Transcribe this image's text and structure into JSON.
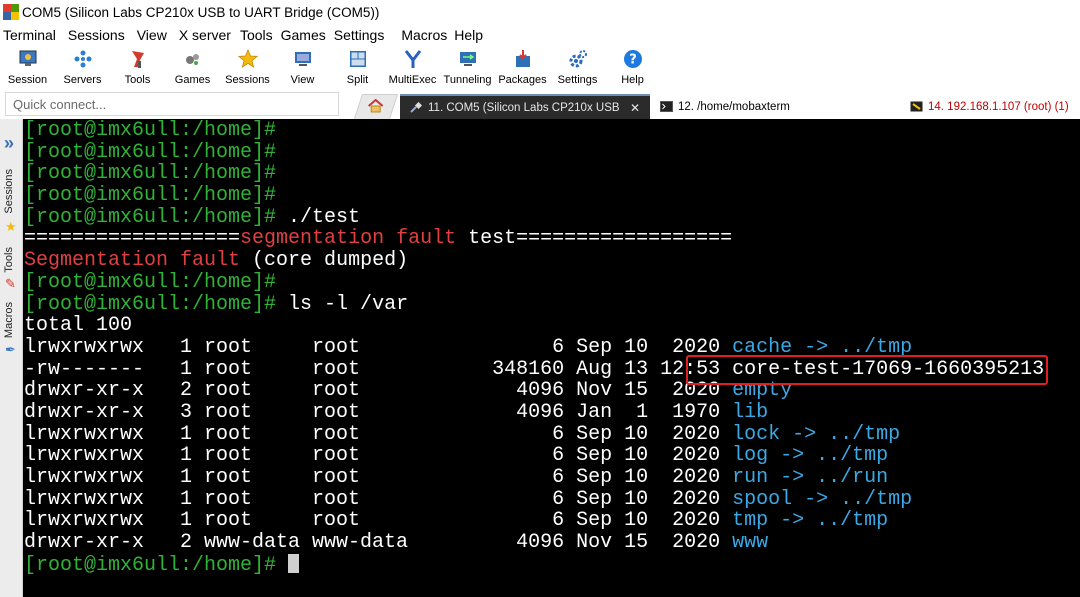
{
  "window": {
    "title": "COM5  (Silicon Labs CP210x USB to UART Bridge (COM5))"
  },
  "menu": [
    "Terminal",
    "Sessions",
    "View",
    "X server",
    "Tools",
    "Games",
    "Settings",
    "Macros",
    "Help"
  ],
  "toolbar": [
    {
      "label": "Session",
      "icon": "monitor-session-icon"
    },
    {
      "label": "Servers",
      "icon": "servers-dots-icon"
    },
    {
      "label": "Tools",
      "icon": "tools-icon"
    },
    {
      "label": "Games",
      "icon": "games-icon"
    },
    {
      "label": "Sessions",
      "icon": "star-icon"
    },
    {
      "label": "View",
      "icon": "view-icon"
    },
    {
      "label": "Split",
      "icon": "split-icon"
    },
    {
      "label": "MultiExec",
      "icon": "multiexec-icon"
    },
    {
      "label": "Tunneling",
      "icon": "tunneling-icon"
    },
    {
      "label": "Packages",
      "icon": "packages-icon"
    },
    {
      "label": "Settings",
      "icon": "gear-icon"
    },
    {
      "label": "Help",
      "icon": "help-icon"
    }
  ],
  "quick_connect": {
    "placeholder": "Quick connect..."
  },
  "tabs": [
    {
      "label": "11. COM5  (Silicon Labs CP210x USB",
      "active": true
    },
    {
      "label": "12. /home/mobaxterm",
      "active": false
    },
    {
      "label": "14. 192.168.1.107 (root) (1)",
      "active": false
    }
  ],
  "sidebar": {
    "sessions": "Sessions",
    "tools": "Tools",
    "macros": "Macros"
  },
  "colors": {
    "prompt": "#2fb336",
    "error": "#e04040",
    "link": "#3aa9e6",
    "highlight_box": "#e02020"
  },
  "terminal": {
    "prompt": "[root@imx6ull:/home]#",
    "lines": [
      {
        "type": "prompt",
        "cmd": ""
      },
      {
        "type": "prompt",
        "cmd": ""
      },
      {
        "type": "prompt",
        "cmd": ""
      },
      {
        "type": "prompt",
        "cmd": ""
      },
      {
        "type": "prompt",
        "cmd": " ./test"
      },
      {
        "type": "banner",
        "left": "==================",
        "red": "segmentation fault",
        "white": " test",
        "right": "=================="
      },
      {
        "type": "error",
        "red": "Segmentation fault",
        "white": " (core dumped)"
      },
      {
        "type": "prompt",
        "cmd": ""
      },
      {
        "type": "prompt",
        "cmd": " ls -l /var"
      },
      {
        "type": "text",
        "text": "total 100"
      },
      {
        "type": "ls",
        "perm": "lrwxrwxrwx",
        "links": "1",
        "owner": "root",
        "group": "root",
        "size": "6",
        "month": "Sep",
        "day": "10",
        "time": "2020",
        "name": "cache",
        "target": " -> ../tmp",
        "name_color": "link"
      },
      {
        "type": "ls",
        "perm": "-rw-------",
        "links": "1",
        "owner": "root",
        "group": "root",
        "size": "348160",
        "month": "Aug",
        "day": "13",
        "time": "12:53",
        "name": "core-test-17069-1660395213",
        "target": "",
        "name_color": "white"
      },
      {
        "type": "ls",
        "perm": "drwxr-xr-x",
        "links": "2",
        "owner": "root",
        "group": "root",
        "size": "4096",
        "month": "Nov",
        "day": "15",
        "time": "2020",
        "name": "empty",
        "target": "",
        "name_color": "link"
      },
      {
        "type": "ls",
        "perm": "drwxr-xr-x",
        "links": "3",
        "owner": "root",
        "group": "root",
        "size": "4096",
        "month": "Jan",
        "day": "1",
        "time": "1970",
        "name": "lib",
        "target": "",
        "name_color": "link"
      },
      {
        "type": "ls",
        "perm": "lrwxrwxrwx",
        "links": "1",
        "owner": "root",
        "group": "root",
        "size": "6",
        "month": "Sep",
        "day": "10",
        "time": "2020",
        "name": "lock",
        "target": " -> ../tmp",
        "name_color": "link"
      },
      {
        "type": "ls",
        "perm": "lrwxrwxrwx",
        "links": "1",
        "owner": "root",
        "group": "root",
        "size": "6",
        "month": "Sep",
        "day": "10",
        "time": "2020",
        "name": "log",
        "target": " -> ../tmp",
        "name_color": "link"
      },
      {
        "type": "ls",
        "perm": "lrwxrwxrwx",
        "links": "1",
        "owner": "root",
        "group": "root",
        "size": "6",
        "month": "Sep",
        "day": "10",
        "time": "2020",
        "name": "run",
        "target": " -> ../run",
        "name_color": "link"
      },
      {
        "type": "ls",
        "perm": "lrwxrwxrwx",
        "links": "1",
        "owner": "root",
        "group": "root",
        "size": "6",
        "month": "Sep",
        "day": "10",
        "time": "2020",
        "name": "spool",
        "target": " -> ../tmp",
        "name_color": "link"
      },
      {
        "type": "ls",
        "perm": "lrwxrwxrwx",
        "links": "1",
        "owner": "root",
        "group": "root",
        "size": "6",
        "month": "Sep",
        "day": "10",
        "time": "2020",
        "name": "tmp",
        "target": " -> ../tmp",
        "name_color": "link"
      },
      {
        "type": "ls",
        "perm": "drwxr-xr-x",
        "links": "2",
        "owner": "www-data",
        "group": "www-data",
        "size": "4096",
        "month": "Nov",
        "day": "15",
        "time": "2020",
        "name": "www",
        "target": "",
        "name_color": "link"
      },
      {
        "type": "prompt_cursor",
        "cmd": " "
      }
    ]
  }
}
